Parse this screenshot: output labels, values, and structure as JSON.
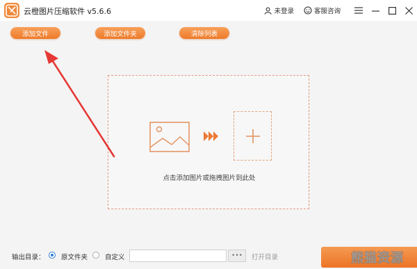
{
  "app": {
    "title": "云橙图片压缩软件 v5.6.6",
    "logo_icon": "scissors-icon"
  },
  "titlebar": {
    "login_label": "未登录",
    "support_label": "客服咨询",
    "icons": [
      "user-icon",
      "headset-icon",
      "menu-icon",
      "minimize-icon",
      "maximize-icon",
      "close-icon"
    ]
  },
  "toolbar": {
    "add_file": "添加文件",
    "add_folder": "添加文件夹",
    "clear_list": "清除列表"
  },
  "dropzone": {
    "hint": "点击添加图片或拖拽图片到此处",
    "icons": [
      "image-icon",
      "fast-forward-icon",
      "plus-icon"
    ]
  },
  "bottom": {
    "output_label": "输出目录：",
    "options": [
      {
        "label": "原文件夹",
        "selected": true
      },
      {
        "label": "自定义",
        "selected": false
      }
    ],
    "path_value": "",
    "browse_label": "•••",
    "open_dir": "打开目录"
  },
  "watermark": {
    "text": "熊猫资源"
  },
  "colors": {
    "accent": "#ee7a2a",
    "arrow": "#e53935",
    "dash": "#e09a80",
    "radio": "#2f7bd8"
  }
}
